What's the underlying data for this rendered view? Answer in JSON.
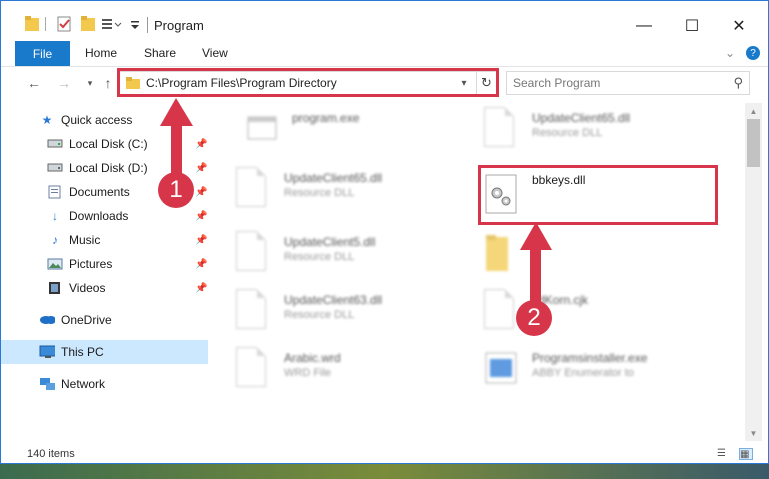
{
  "window": {
    "title": "Program",
    "controls": {
      "minimize": "—",
      "maximize": "☐",
      "close": "✕"
    }
  },
  "ribbon": {
    "tabs": [
      "File",
      "Home",
      "Share",
      "View"
    ],
    "help": "?"
  },
  "nav": {
    "address": "C:\\Program Files\\Program Directory",
    "search_placeholder": "Search Program"
  },
  "sidebar": {
    "items": [
      {
        "label": "Quick access",
        "icon": "star-icon",
        "pinned": false
      },
      {
        "label": "Local Disk (C:)",
        "icon": "drive-icon",
        "pinned": true
      },
      {
        "label": "Local Disk (D:)",
        "icon": "drive-icon",
        "pinned": true
      },
      {
        "label": "Documents",
        "icon": "documents-icon",
        "pinned": true
      },
      {
        "label": "Downloads",
        "icon": "download-icon",
        "pinned": true
      },
      {
        "label": "Music",
        "icon": "music-icon",
        "pinned": true
      },
      {
        "label": "Pictures",
        "icon": "pictures-icon",
        "pinned": true
      },
      {
        "label": "Videos",
        "icon": "videos-icon",
        "pinned": true
      },
      {
        "label": "OneDrive",
        "icon": "cloud-icon",
        "pinned": false
      },
      {
        "label": "This PC",
        "icon": "computer-icon",
        "pinned": false,
        "selected": true
      },
      {
        "label": "Network",
        "icon": "network-icon",
        "pinned": false
      }
    ]
  },
  "files": {
    "left": [
      {
        "name": "program.exe",
        "type": ""
      },
      {
        "name": "UpdateClient65.dll",
        "type": "Resource DLL"
      },
      {
        "name": "UpdateClient5.dll",
        "type": "Resource DLL"
      },
      {
        "name": "UpdateClient63.dll",
        "type": "Resource DLL"
      },
      {
        "name": "Arabic.wrd",
        "type": "WRD File"
      }
    ],
    "right": [
      {
        "name": "UpdateClient65.dll",
        "type": "Resource DLL"
      },
      {
        "name": "bbkeys.dll",
        "type": ""
      },
      {
        "name": "",
        "type": ""
      },
      {
        "name": "xdKorn.cjk",
        "type": "File"
      },
      {
        "name": "Programsinstaller.exe",
        "type": "ABBY Enumerator to"
      }
    ]
  },
  "status": {
    "item_count": "140 items"
  },
  "annotations": {
    "step1": "1",
    "step2": "2",
    "color": "#d7364a"
  }
}
